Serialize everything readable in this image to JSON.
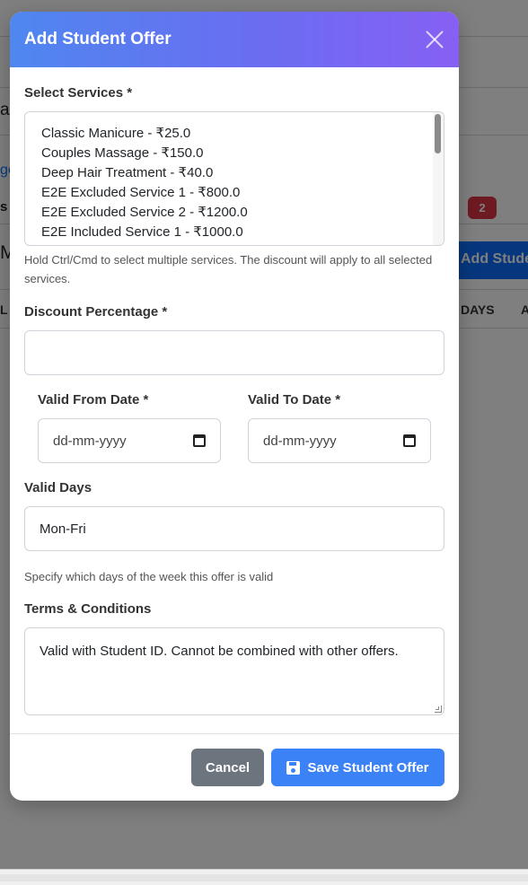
{
  "background": {
    "fragment_a": "a",
    "fragment_ge": "ge",
    "fragment_sn": "s N",
    "fragment_m": "M",
    "fragment_l": "L",
    "pill_link": "s",
    "badge_count": "2",
    "add_button_label": "Add Stude",
    "col_days": "DAYS",
    "col_a": "A"
  },
  "modal": {
    "title": "Add Student Offer",
    "services": {
      "label": "Select Services *",
      "options": [
        "Classic Manicure - ₹25.0",
        "Couples Massage - ₹150.0",
        "Deep Hair Treatment - ₹40.0",
        "E2E Excluded Service 1 - ₹800.0",
        "E2E Excluded Service 2 - ₹1200.0",
        "E2E Included Service 1 - ₹1000.0"
      ],
      "hint": "Hold Ctrl/Cmd to select multiple services. The discount will apply to all selected services."
    },
    "discount": {
      "label": "Discount Percentage *",
      "value": ""
    },
    "valid_from": {
      "label": "Valid From Date *",
      "placeholder": "dd-mm-yyyy"
    },
    "valid_to": {
      "label": "Valid To Date *",
      "placeholder": "dd-mm-yyyy"
    },
    "valid_days": {
      "label": "Valid Days",
      "value": "Mon-Fri",
      "hint": "Specify which days of the week this offer is valid"
    },
    "terms": {
      "label": "Terms & Conditions",
      "value": "Valid with Student ID. Cannot be combined with other offers."
    },
    "footer": {
      "cancel_label": "Cancel",
      "save_label": "Save Student Offer"
    }
  },
  "colors": {
    "header_gradient_start": "#4f87f0",
    "header_gradient_end": "#8660f3",
    "primary": "#3b82f6",
    "secondary": "#6c757d",
    "danger": "#dc3545"
  }
}
